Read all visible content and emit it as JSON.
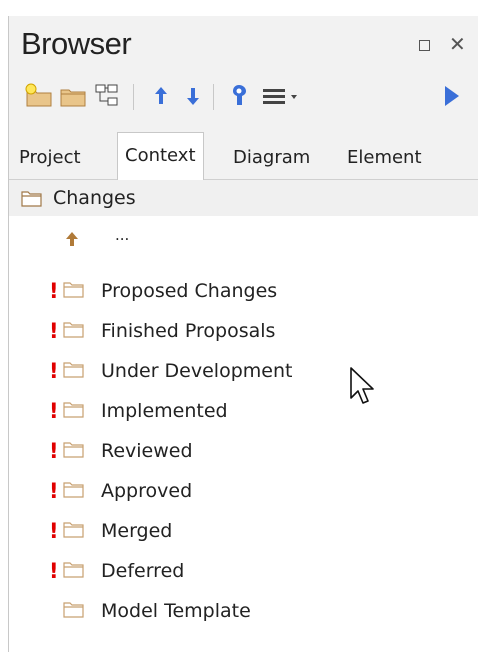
{
  "panel": {
    "title": "Browser"
  },
  "tabs": [
    {
      "label": "Project",
      "active": false
    },
    {
      "label": "Context",
      "active": true
    },
    {
      "label": "Diagram",
      "active": false
    },
    {
      "label": "Element",
      "active": false
    }
  ],
  "toolbar": {
    "icons": [
      "new-package-icon",
      "folder-icon",
      "structure-icon",
      "move-up-icon",
      "move-down-icon",
      "locate-icon",
      "menu-icon",
      "play-icon"
    ]
  },
  "tree": {
    "root": "Changes",
    "parent_link": "...",
    "items": [
      {
        "label": "Proposed Changes",
        "flag": "!"
      },
      {
        "label": "Finished Proposals",
        "flag": "!"
      },
      {
        "label": "Under Development",
        "flag": "!"
      },
      {
        "label": "Implemented",
        "flag": "!"
      },
      {
        "label": "Reviewed",
        "flag": "!"
      },
      {
        "label": "Approved",
        "flag": "!"
      },
      {
        "label": "Merged",
        "flag": "!"
      },
      {
        "label": "Deferred",
        "flag": "!"
      },
      {
        "label": "Model Template",
        "flag": ""
      }
    ]
  },
  "colors": {
    "folder": "#c8a070",
    "flag": "#e00000",
    "accent": "#3a6fd8",
    "arrow": "#b07a38"
  }
}
